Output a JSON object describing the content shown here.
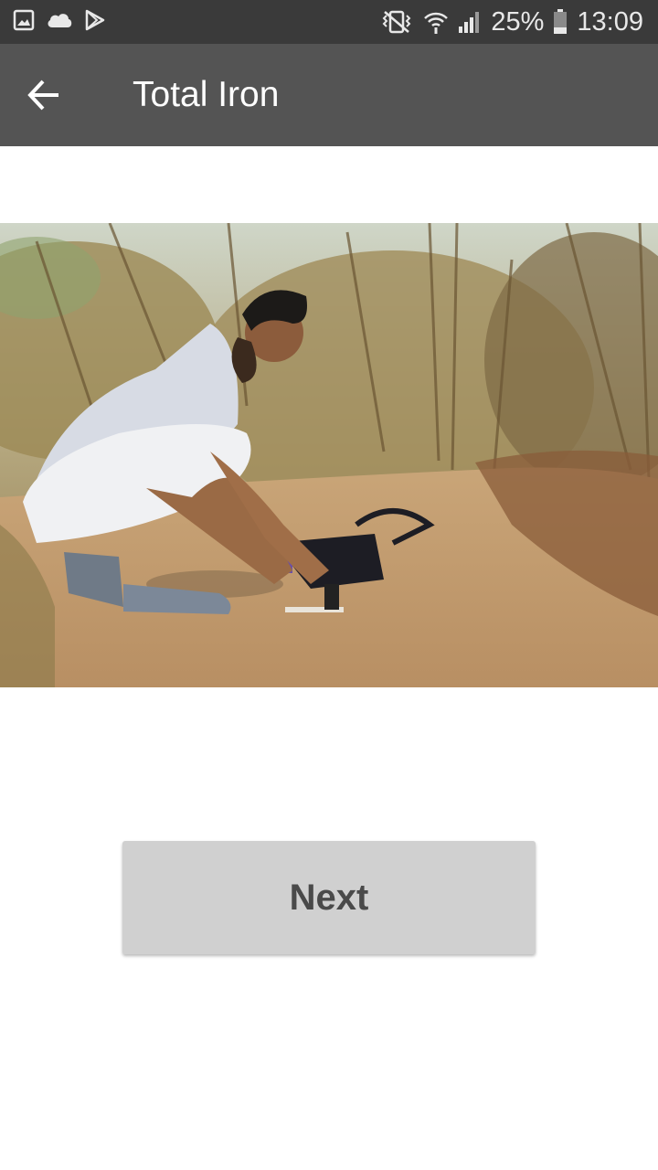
{
  "status_bar": {
    "icons_left": [
      "image-icon",
      "cloud-icon",
      "play-store-icon"
    ],
    "icons_right": [
      "vibrate-icon",
      "wifi-icon",
      "signal-icon",
      "battery-icon"
    ],
    "battery": "25%",
    "time": "13:09",
    "background": "#3a3a3a"
  },
  "app_bar": {
    "title": "Total Iron",
    "back_icon": "arrow-back-icon",
    "background": "#545454"
  },
  "main": {
    "image": "photo-of-man-testing-water-on-dirt-path",
    "next_label": "Next",
    "next_button_color": "#d0d0d0"
  }
}
